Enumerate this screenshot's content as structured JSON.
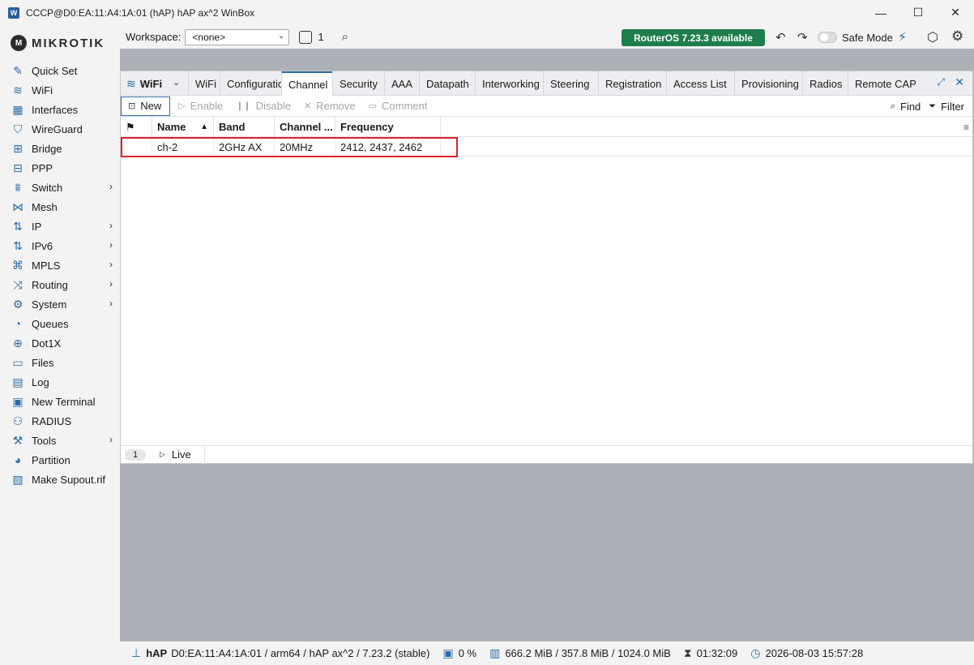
{
  "window": {
    "title": "CCCP@D0:EA:11:A4:1A:01 (hAP) hAP ax^2 WinBox",
    "minimize_icon": "minimize-icon",
    "maximize_icon": "maximize-icon",
    "close_icon": "close-icon"
  },
  "logo": {
    "text": "MIKROTIK"
  },
  "sidebar": {
    "items": [
      {
        "label": "Quick Set",
        "icon": "wand-icon",
        "glyph": "✎",
        "chevron": false
      },
      {
        "label": "WiFi",
        "icon": "wifi-icon",
        "glyph": "≋",
        "chevron": false
      },
      {
        "label": "Interfaces",
        "icon": "interfaces-icon",
        "glyph": "▦",
        "chevron": false
      },
      {
        "label": "WireGuard",
        "icon": "shield-icon",
        "glyph": "⛉",
        "chevron": false
      },
      {
        "label": "Bridge",
        "icon": "bridge-icon",
        "glyph": "⊞",
        "chevron": false
      },
      {
        "label": "PPP",
        "icon": "ppp-icon",
        "glyph": "⊟",
        "chevron": false
      },
      {
        "label": "Switch",
        "icon": "switch-icon",
        "glyph": "⩩",
        "chevron": true
      },
      {
        "label": "Mesh",
        "icon": "mesh-icon",
        "glyph": "⋈",
        "chevron": false
      },
      {
        "label": "IP",
        "icon": "ip-icon",
        "glyph": "⇅",
        "chevron": true
      },
      {
        "label": "IPv6",
        "icon": "ipv6-icon",
        "glyph": "⇅",
        "chevron": true
      },
      {
        "label": "MPLS",
        "icon": "tag-icon",
        "glyph": "⌘",
        "chevron": true
      },
      {
        "label": "Routing",
        "icon": "routing-icon",
        "glyph": "⤨",
        "chevron": true
      },
      {
        "label": "System",
        "icon": "gear-icon",
        "glyph": "⚙",
        "chevron": true
      },
      {
        "label": "Queues",
        "icon": "gauge-icon",
        "glyph": "◔",
        "chevron": false
      },
      {
        "label": "Dot1X",
        "icon": "dot1x-icon",
        "glyph": "⊕",
        "chevron": false
      },
      {
        "label": "Files",
        "icon": "folder-icon",
        "glyph": "▭",
        "chevron": false
      },
      {
        "label": "Log",
        "icon": "log-icon",
        "glyph": "▤",
        "chevron": false
      },
      {
        "label": "New Terminal",
        "icon": "terminal-icon",
        "glyph": "▣",
        "chevron": false
      },
      {
        "label": "RADIUS",
        "icon": "radius-icon",
        "glyph": "⚇",
        "chevron": false
      },
      {
        "label": "Tools",
        "icon": "tools-icon",
        "glyph": "⚒",
        "chevron": true
      },
      {
        "label": "Partition",
        "icon": "partition-icon",
        "glyph": "◕",
        "chevron": false
      },
      {
        "label": "Make Supout.rif",
        "icon": "file-icon",
        "glyph": "▧",
        "chevron": false
      }
    ]
  },
  "topbar": {
    "workspace_label": "Workspace:",
    "workspace_value": "<none>",
    "window_count": "1",
    "update_label": "RouterOS 7.23.3 available",
    "safe_mode_label": "Safe Mode"
  },
  "wifi_window": {
    "title": "WiFi",
    "tabs": [
      {
        "label": "WiFi",
        "width": 39
      },
      {
        "label": "Configuration",
        "width": 76
      },
      {
        "label": "Channel",
        "width": 63,
        "active": true
      },
      {
        "label": "Security",
        "width": 64
      },
      {
        "label": "AAA",
        "width": 43
      },
      {
        "label": "Datapath",
        "width": 69
      },
      {
        "label": "Interworking",
        "width": 84
      },
      {
        "label": "Steering",
        "width": 68
      },
      {
        "label": "Registration",
        "width": 84
      },
      {
        "label": "Access List",
        "width": 84
      },
      {
        "label": "Provisioning",
        "width": 84
      },
      {
        "label": "Radios",
        "width": 56
      },
      {
        "label": "Remote CAP",
        "width": 84
      }
    ],
    "actions": {
      "new": "New",
      "enable": "Enable",
      "disable": "Disable",
      "remove": "Remove",
      "comment": "Comment",
      "find": "Find",
      "filter": "Filter"
    },
    "columns": {
      "name": "Name",
      "band": "Band",
      "channel": "Channel ...",
      "frequency": "Frequency"
    },
    "rows": [
      {
        "name": "ch-2",
        "band": "2GHz AX",
        "channel": "20MHz",
        "frequency": "2412, 2437, 2462"
      }
    ],
    "count": "1",
    "live_label": "Live"
  },
  "statusbar": {
    "device": "hAP",
    "info": "D0:EA:11:A4:1A:01 / arm64 / hAP ax^2 / 7.23.2 (stable)",
    "cpu": "0 %",
    "memory": "666.2 MiB / 357.8 MiB / 1024.0 MiB",
    "uptime": "01:32:09",
    "datetime": "2026-08-03 15:57:28"
  }
}
